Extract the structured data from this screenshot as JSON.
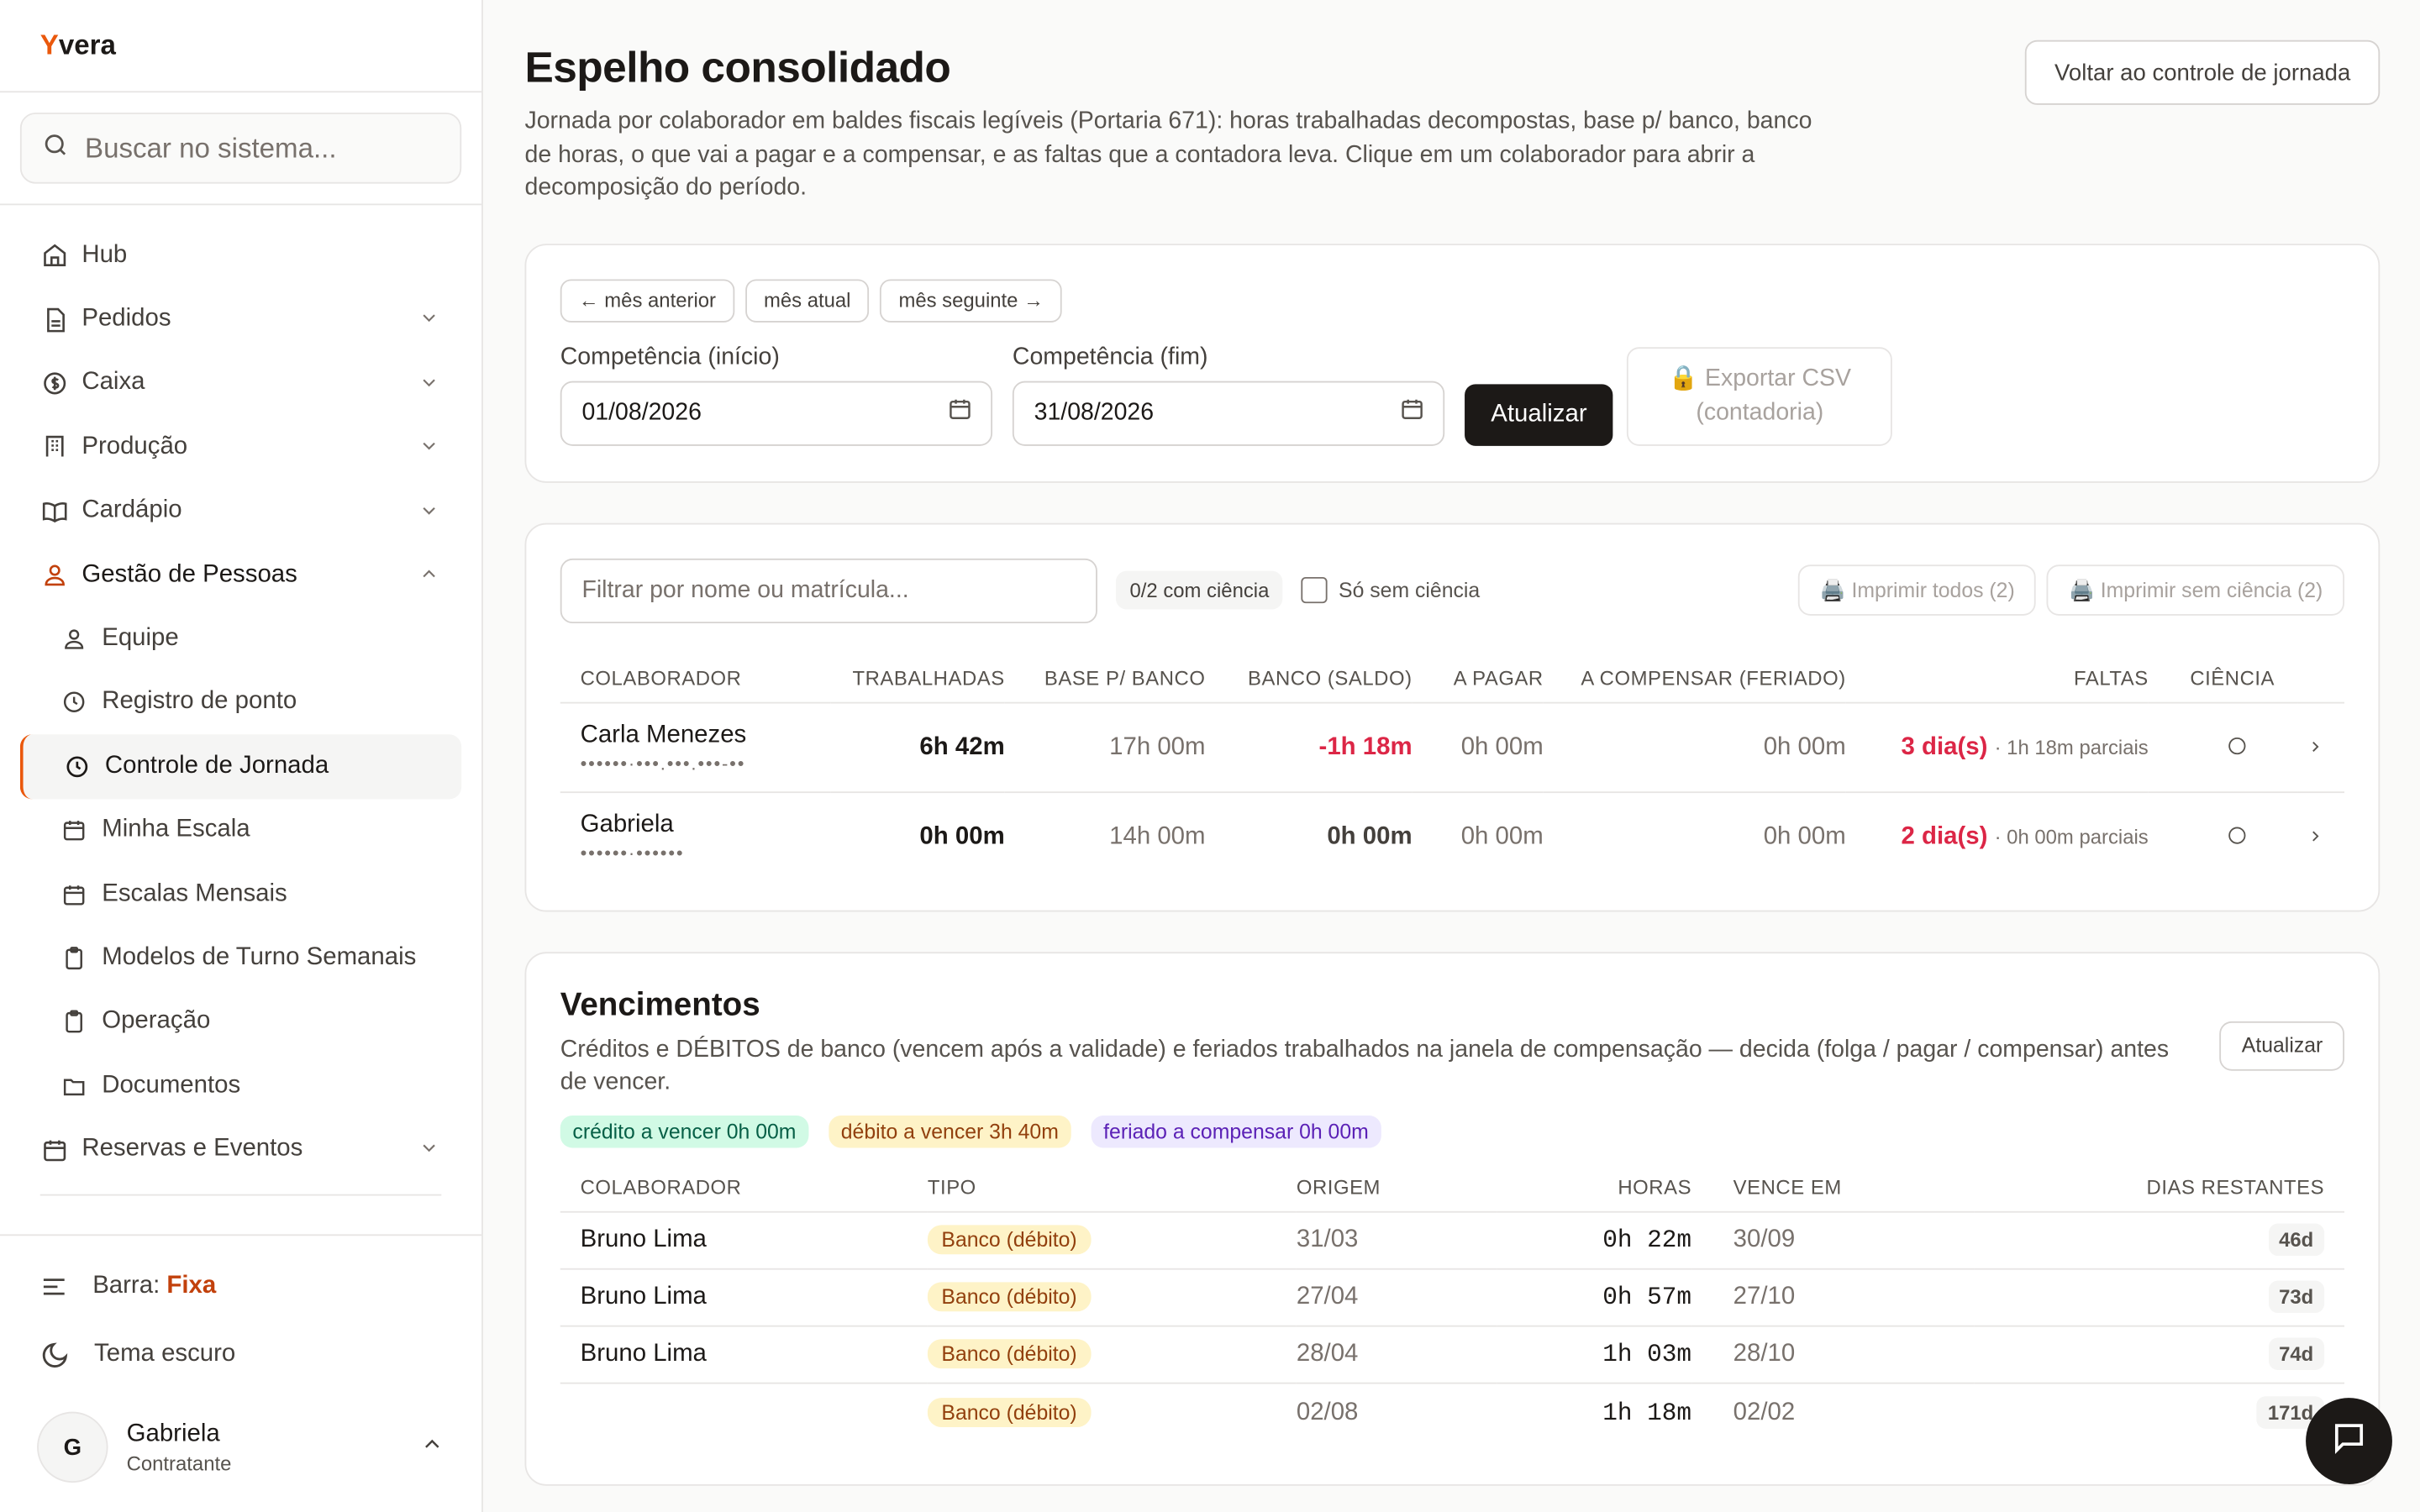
{
  "brand": {
    "initial": "Y",
    "rest": "vera"
  },
  "search": {
    "placeholder": "Buscar no sistema..."
  },
  "nav": [
    {
      "label": "Hub",
      "icon": "home-icon"
    },
    {
      "label": "Pedidos",
      "icon": "document-icon"
    },
    {
      "label": "Caixa",
      "icon": "dollar-icon"
    },
    {
      "label": "Produção",
      "icon": "building-icon"
    },
    {
      "label": "Cardápio",
      "icon": "book-icon"
    },
    {
      "label": "Gestão de Pessoas",
      "icon": "users-icon"
    }
  ],
  "subnav": [
    {
      "label": "Equipe",
      "icon": "users-icon"
    },
    {
      "label": "Registro de ponto",
      "icon": "clock-icon"
    },
    {
      "label": "Controle de Jornada",
      "icon": "clock-icon"
    },
    {
      "label": "Minha Escala",
      "icon": "calendar-icon"
    },
    {
      "label": "Escalas Mensais",
      "icon": "calendar-icon"
    },
    {
      "label": "Modelos de Turno Semanais",
      "icon": "clipboard-icon"
    },
    {
      "label": "Operação",
      "icon": "clipboard-icon"
    },
    {
      "label": "Documentos",
      "icon": "folder-icon"
    }
  ],
  "nav_bottom": {
    "label": "Reservas e Eventos",
    "icon": "calendar-icon"
  },
  "sidebar_footer": {
    "bar_label": "Barra:",
    "bar_value": "Fixa",
    "theme": "Tema escuro",
    "user_initial": "G",
    "user_name": "Gabriela",
    "user_role": "Contratante"
  },
  "page": {
    "title": "Espelho consolidado",
    "description": "Jornada por colaborador em baldes fiscais legíveis (Portaria 671): horas trabalhadas decompostas, base p/ banco, banco de horas, o que vai a pagar e a compensar, e as faltas que a contadora leva. Clique em um colaborador para abrir a decomposição do período.",
    "back_button": "Voltar ao controle de jornada"
  },
  "period": {
    "prev": "← mês anterior",
    "current": "mês atual",
    "next": "mês seguinte →",
    "start_label": "Competência (início)",
    "start_value": "01/08/2026",
    "end_label": "Competência (fim)",
    "end_value": "31/08/2026",
    "update": "Atualizar",
    "export_line1": "🔒 Exportar CSV",
    "export_line2": "(contadoria)"
  },
  "employees": {
    "filter_placeholder": "Filtrar por nome ou matrícula...",
    "ack_count": "0/2 com ciência",
    "only_unacked": "Só sem ciência",
    "print_all": "🖨️ Imprimir todos (2)",
    "print_unacked": "🖨️ Imprimir sem ciência (2)",
    "columns": [
      "COLABORADOR",
      "TRABALHADAS",
      "BASE P/ BANCO",
      "BANCO (SALDO)",
      "A PAGAR",
      "A COMPENSAR (FERIADO)",
      "FALTAS",
      "CIÊNCIA"
    ],
    "rows": [
      {
        "name": "Carla Menezes",
        "id": "••••••·•••.•••.•••-••",
        "worked": "6h 42m",
        "base": "17h 00m",
        "balance": "-1h 18m",
        "pay": "0h 00m",
        "comp": "0h 00m",
        "absences": "3 dia(s)",
        "partial": "· 1h 18m parciais"
      },
      {
        "name": "Gabriela",
        "id": "••••••·••••••",
        "worked": "0h 00m",
        "base": "14h 00m",
        "balance": "0h 00m",
        "pay": "0h 00m",
        "comp": "0h 00m",
        "absences": "2 dia(s)",
        "partial": "· 0h 00m parciais"
      }
    ]
  },
  "expirations": {
    "title": "Vencimentos",
    "description": "Créditos e DÉBITOS de banco (vencem após a validade) e feriados trabalhados na janela de compensação — decida (folga / pagar / compensar) antes de vencer.",
    "update": "Atualizar",
    "tags": [
      {
        "label": "crédito a vencer 0h 00m",
        "bg": "#d1fae5",
        "fg": "#065f46"
      },
      {
        "label": "débito a vencer 3h 40m",
        "bg": "#fef3c7",
        "fg": "#92400e"
      },
      {
        "label": "feriado a compensar 0h 00m",
        "bg": "#ede9fe",
        "fg": "#5b21b6"
      }
    ],
    "columns": [
      "COLABORADOR",
      "TIPO",
      "ORIGEM",
      "HORAS",
      "VENCE EM",
      "DIAS RESTANTES"
    ],
    "rows": [
      {
        "name": "Bruno Lima",
        "type": "Banco (débito)",
        "origin": "31/03",
        "hours": "0h 22m",
        "due": "30/09",
        "days": "46d"
      },
      {
        "name": "Bruno Lima",
        "type": "Banco (débito)",
        "origin": "27/04",
        "hours": "0h 57m",
        "due": "27/10",
        "days": "73d"
      },
      {
        "name": "Bruno Lima",
        "type": "Banco (débito)",
        "origin": "28/04",
        "hours": "1h 03m",
        "due": "28/10",
        "days": "74d"
      },
      {
        "name": "",
        "type": "Banco (débito)",
        "origin": "02/08",
        "hours": "1h 18m",
        "due": "02/02",
        "days": "171d"
      }
    ]
  },
  "colors": {
    "accent": "#ea580c",
    "danger": "#dc2646",
    "dark": "#1c1917"
  }
}
